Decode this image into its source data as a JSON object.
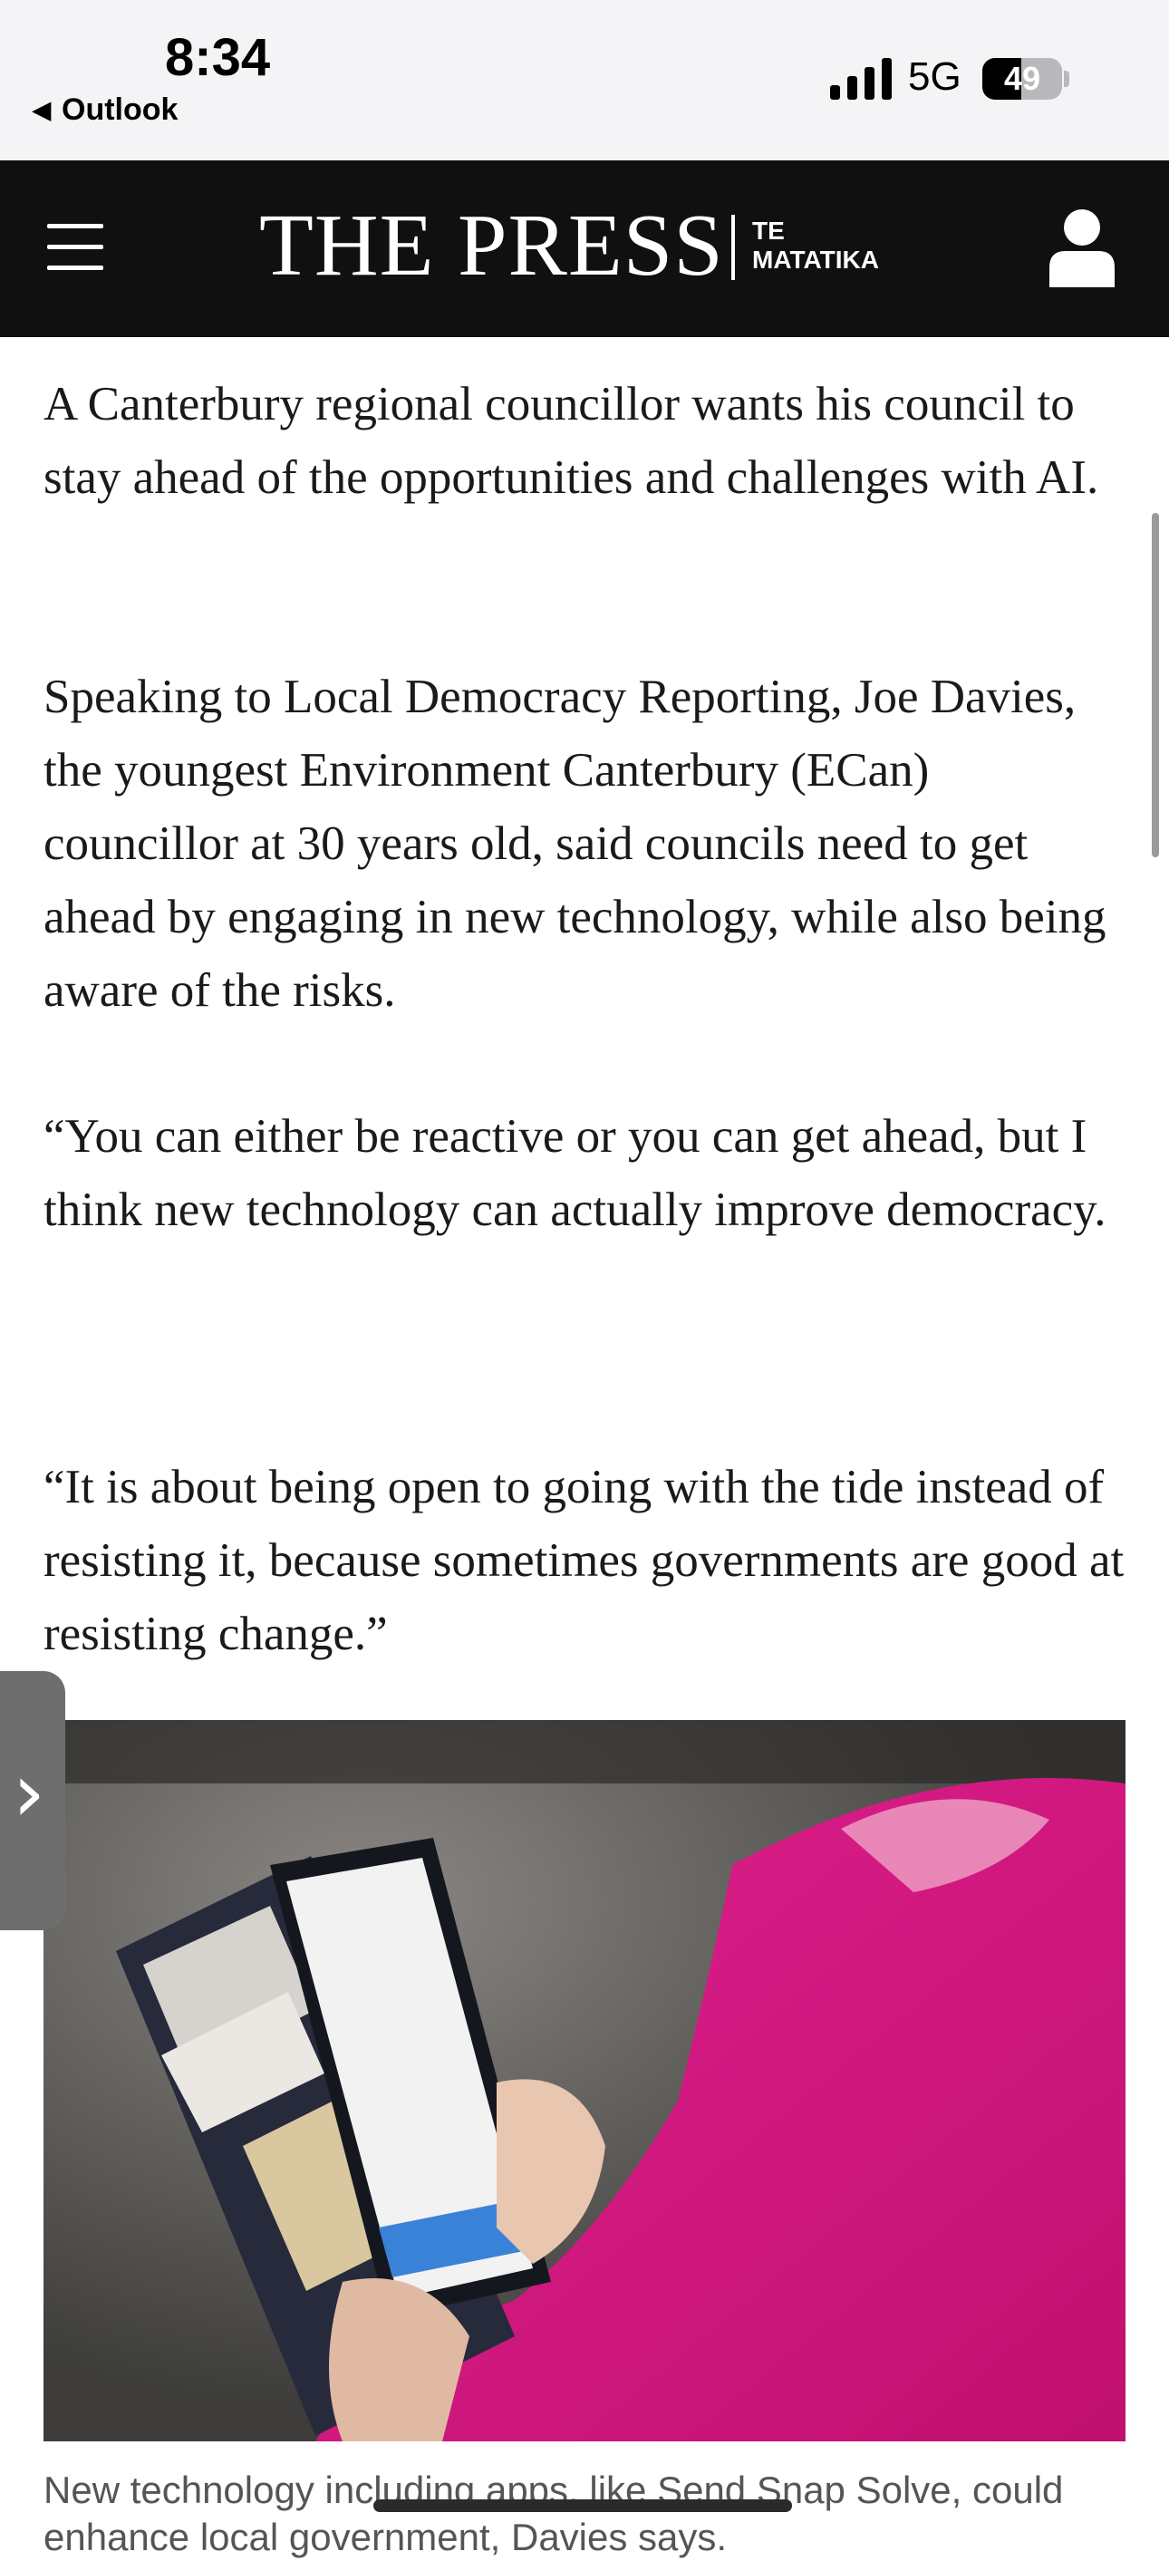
{
  "status_bar": {
    "time": "8:34",
    "back_app": "Outlook",
    "back_icon": "back-triangle-icon",
    "network": "5G",
    "battery_percent": 49,
    "battery_label": "49"
  },
  "header": {
    "logo_main": "THE PRESS",
    "logo_sub_line1": "TE",
    "logo_sub_line2": "MATATIKA",
    "menu_icon": "hamburger-menu-icon",
    "account_icon": "user-account-icon",
    "background": "#101010"
  },
  "article": {
    "paragraphs": [
      "A Canterbury regional councillor wants his council to stay ahead of the opportunities and challenges with AI.",
      "Speaking to Local Democracy Reporting, Joe Davies, the youngest Environment Canterbury (ECan) councillor at 30 years old, said councils need to get ahead by engaging in new technology, while also being aware of the risks.",
      "“You can either be reactive or you can get ahead, but I think new technology can actually improve democracy.",
      "“It is about being open to going with the tide instead of resisting it, because sometimes governments are good at resisting change.”"
    ],
    "photo_icon": "article-photo-phone-wallet",
    "caption": "New technology including apps, like Send Snap Solve, could enhance local government, Davies says."
  },
  "side_tab_icon": "chevron-right-icon"
}
